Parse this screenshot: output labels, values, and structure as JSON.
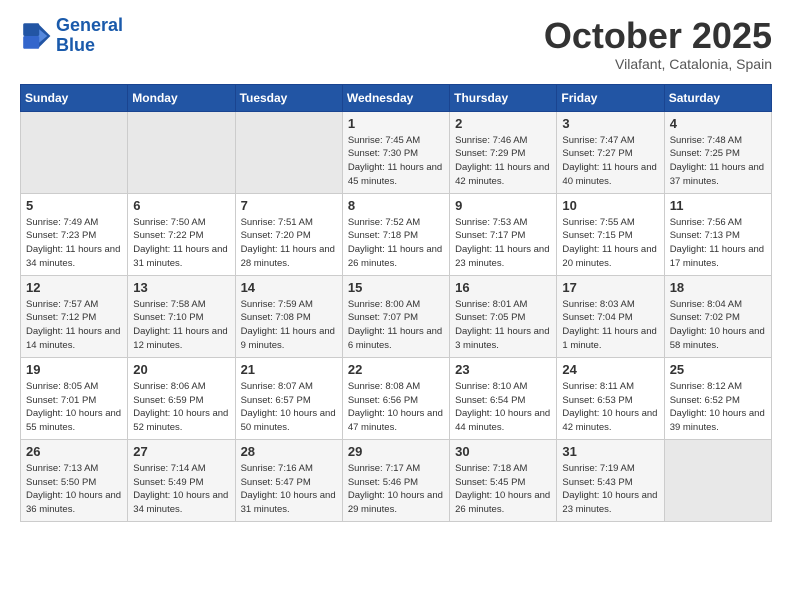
{
  "header": {
    "logo_line1": "General",
    "logo_line2": "Blue",
    "month": "October 2025",
    "location": "Vilafant, Catalonia, Spain"
  },
  "weekdays": [
    "Sunday",
    "Monday",
    "Tuesday",
    "Wednesday",
    "Thursday",
    "Friday",
    "Saturday"
  ],
  "weeks": [
    [
      {
        "day": "",
        "empty": true
      },
      {
        "day": "",
        "empty": true
      },
      {
        "day": "",
        "empty": true
      },
      {
        "day": "1",
        "sunrise": "Sunrise: 7:45 AM",
        "sunset": "Sunset: 7:30 PM",
        "daylight": "Daylight: 11 hours and 45 minutes."
      },
      {
        "day": "2",
        "sunrise": "Sunrise: 7:46 AM",
        "sunset": "Sunset: 7:29 PM",
        "daylight": "Daylight: 11 hours and 42 minutes."
      },
      {
        "day": "3",
        "sunrise": "Sunrise: 7:47 AM",
        "sunset": "Sunset: 7:27 PM",
        "daylight": "Daylight: 11 hours and 40 minutes."
      },
      {
        "day": "4",
        "sunrise": "Sunrise: 7:48 AM",
        "sunset": "Sunset: 7:25 PM",
        "daylight": "Daylight: 11 hours and 37 minutes."
      }
    ],
    [
      {
        "day": "5",
        "sunrise": "Sunrise: 7:49 AM",
        "sunset": "Sunset: 7:23 PM",
        "daylight": "Daylight: 11 hours and 34 minutes."
      },
      {
        "day": "6",
        "sunrise": "Sunrise: 7:50 AM",
        "sunset": "Sunset: 7:22 PM",
        "daylight": "Daylight: 11 hours and 31 minutes."
      },
      {
        "day": "7",
        "sunrise": "Sunrise: 7:51 AM",
        "sunset": "Sunset: 7:20 PM",
        "daylight": "Daylight: 11 hours and 28 minutes."
      },
      {
        "day": "8",
        "sunrise": "Sunrise: 7:52 AM",
        "sunset": "Sunset: 7:18 PM",
        "daylight": "Daylight: 11 hours and 26 minutes."
      },
      {
        "day": "9",
        "sunrise": "Sunrise: 7:53 AM",
        "sunset": "Sunset: 7:17 PM",
        "daylight": "Daylight: 11 hours and 23 minutes."
      },
      {
        "day": "10",
        "sunrise": "Sunrise: 7:55 AM",
        "sunset": "Sunset: 7:15 PM",
        "daylight": "Daylight: 11 hours and 20 minutes."
      },
      {
        "day": "11",
        "sunrise": "Sunrise: 7:56 AM",
        "sunset": "Sunset: 7:13 PM",
        "daylight": "Daylight: 11 hours and 17 minutes."
      }
    ],
    [
      {
        "day": "12",
        "sunrise": "Sunrise: 7:57 AM",
        "sunset": "Sunset: 7:12 PM",
        "daylight": "Daylight: 11 hours and 14 minutes."
      },
      {
        "day": "13",
        "sunrise": "Sunrise: 7:58 AM",
        "sunset": "Sunset: 7:10 PM",
        "daylight": "Daylight: 11 hours and 12 minutes."
      },
      {
        "day": "14",
        "sunrise": "Sunrise: 7:59 AM",
        "sunset": "Sunset: 7:08 PM",
        "daylight": "Daylight: 11 hours and 9 minutes."
      },
      {
        "day": "15",
        "sunrise": "Sunrise: 8:00 AM",
        "sunset": "Sunset: 7:07 PM",
        "daylight": "Daylight: 11 hours and 6 minutes."
      },
      {
        "day": "16",
        "sunrise": "Sunrise: 8:01 AM",
        "sunset": "Sunset: 7:05 PM",
        "daylight": "Daylight: 11 hours and 3 minutes."
      },
      {
        "day": "17",
        "sunrise": "Sunrise: 8:03 AM",
        "sunset": "Sunset: 7:04 PM",
        "daylight": "Daylight: 11 hours and 1 minute."
      },
      {
        "day": "18",
        "sunrise": "Sunrise: 8:04 AM",
        "sunset": "Sunset: 7:02 PM",
        "daylight": "Daylight: 10 hours and 58 minutes."
      }
    ],
    [
      {
        "day": "19",
        "sunrise": "Sunrise: 8:05 AM",
        "sunset": "Sunset: 7:01 PM",
        "daylight": "Daylight: 10 hours and 55 minutes."
      },
      {
        "day": "20",
        "sunrise": "Sunrise: 8:06 AM",
        "sunset": "Sunset: 6:59 PM",
        "daylight": "Daylight: 10 hours and 52 minutes."
      },
      {
        "day": "21",
        "sunrise": "Sunrise: 8:07 AM",
        "sunset": "Sunset: 6:57 PM",
        "daylight": "Daylight: 10 hours and 50 minutes."
      },
      {
        "day": "22",
        "sunrise": "Sunrise: 8:08 AM",
        "sunset": "Sunset: 6:56 PM",
        "daylight": "Daylight: 10 hours and 47 minutes."
      },
      {
        "day": "23",
        "sunrise": "Sunrise: 8:10 AM",
        "sunset": "Sunset: 6:54 PM",
        "daylight": "Daylight: 10 hours and 44 minutes."
      },
      {
        "day": "24",
        "sunrise": "Sunrise: 8:11 AM",
        "sunset": "Sunset: 6:53 PM",
        "daylight": "Daylight: 10 hours and 42 minutes."
      },
      {
        "day": "25",
        "sunrise": "Sunrise: 8:12 AM",
        "sunset": "Sunset: 6:52 PM",
        "daylight": "Daylight: 10 hours and 39 minutes."
      }
    ],
    [
      {
        "day": "26",
        "sunrise": "Sunrise: 7:13 AM",
        "sunset": "Sunset: 5:50 PM",
        "daylight": "Daylight: 10 hours and 36 minutes."
      },
      {
        "day": "27",
        "sunrise": "Sunrise: 7:14 AM",
        "sunset": "Sunset: 5:49 PM",
        "daylight": "Daylight: 10 hours and 34 minutes."
      },
      {
        "day": "28",
        "sunrise": "Sunrise: 7:16 AM",
        "sunset": "Sunset: 5:47 PM",
        "daylight": "Daylight: 10 hours and 31 minutes."
      },
      {
        "day": "29",
        "sunrise": "Sunrise: 7:17 AM",
        "sunset": "Sunset: 5:46 PM",
        "daylight": "Daylight: 10 hours and 29 minutes."
      },
      {
        "day": "30",
        "sunrise": "Sunrise: 7:18 AM",
        "sunset": "Sunset: 5:45 PM",
        "daylight": "Daylight: 10 hours and 26 minutes."
      },
      {
        "day": "31",
        "sunrise": "Sunrise: 7:19 AM",
        "sunset": "Sunset: 5:43 PM",
        "daylight": "Daylight: 10 hours and 23 minutes."
      },
      {
        "day": "",
        "empty": true
      }
    ]
  ]
}
